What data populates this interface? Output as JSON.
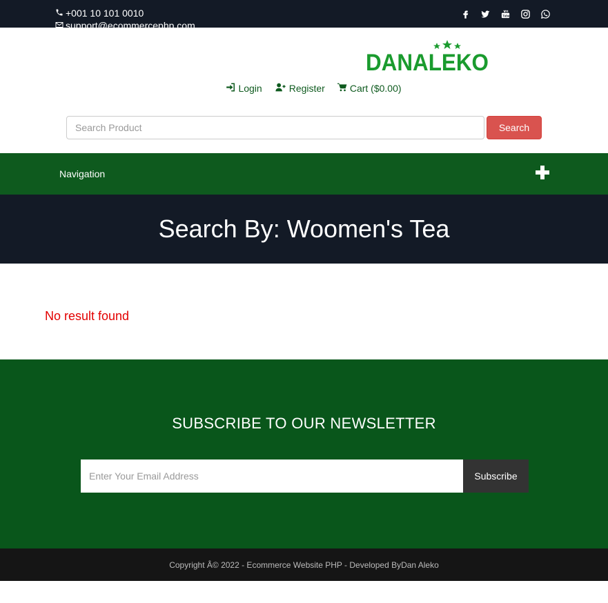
{
  "topbar": {
    "phone": "+001 10 101 0010",
    "email": "support@ecommercephp.com",
    "socials": [
      "facebook-icon",
      "twitter-icon",
      "youtube-icon",
      "instagram-icon",
      "whatsapp-icon"
    ]
  },
  "logo": {
    "text": "DANALEKO"
  },
  "account": {
    "login": "Login",
    "register": "Register",
    "cart": "Cart ($0.00)"
  },
  "search": {
    "placeholder": "Search Product",
    "button": "Search"
  },
  "nav": {
    "label": "Navigation"
  },
  "banner": {
    "title": "Search By: Woomen's Tea"
  },
  "result": {
    "message": "No result found"
  },
  "newsletter": {
    "title": "SUBSCRIBE TO OUR NEWSLETTER",
    "placeholder": "Enter Your Email Address",
    "button": "Subscribe"
  },
  "footer": {
    "copyright": "Copyright Â© 2022 - Ecommerce Website PHP - Developed ByDan Aleko"
  },
  "colors": {
    "dark": "#131a26",
    "green": "#0e5a1e",
    "newsletter_green": "#09561b",
    "search_button": "#d9534f",
    "error": "#e30000"
  }
}
